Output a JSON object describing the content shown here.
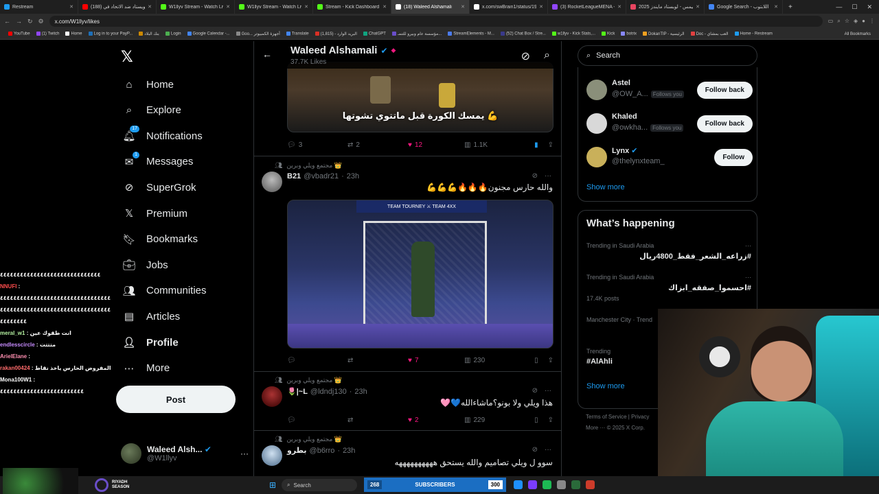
{
  "browser": {
    "tabs": [
      {
        "title": "Restream",
        "color": "#1d9bf0"
      },
      {
        "title": "(188) لويستاد ضد الاتحاد في",
        "color": "#ff0000"
      },
      {
        "title": "W1llyv Stream - Watch Live o",
        "color": "#53fc18"
      },
      {
        "title": "W1llyv Stream - Watch Live o",
        "color": "#53fc18"
      },
      {
        "title": "Stream - Kick Dashboard",
        "color": "#53fc18"
      },
      {
        "title": "(18) Waleed Alshamali",
        "color": "#ffffff"
      },
      {
        "title": "x.com/swBrain1/status/1945",
        "color": "#ffffff"
      },
      {
        "title": "(3) RocketLeagueMENA - Twi",
        "color": "#9146ff"
      },
      {
        "title": "2025 جيمس - لوبستاد مايندز",
        "color": "#e94560"
      },
      {
        "title": "Google Search - اللابتوب",
        "color": "#4285f4"
      }
    ],
    "url": "x.com/W1llyv/likes",
    "bookmarks": [
      "YouTube",
      "(1) Twitch",
      "Home",
      "Log in to your PayP...",
      "بنك البلاد",
      "Login",
      "Google Calendar -...",
      "Goo... أجهزة الكمبيوتر",
      "Translate",
      "(1,815) - البريد الوارد",
      "ChatGPT",
      "مؤسسة عام وبيرو للتنمـ...",
      "StreamElements - M...",
      "(52) Chat Box / Stre...",
      "w1llyv - Kick Stats,...",
      "Kick",
      "botrix",
      "DokanTIP - الرئيسية",
      "Doc - العب بمشاي",
      "Home - Restream"
    ],
    "all_bookmarks": "All Bookmarks"
  },
  "sidebar": {
    "items": [
      {
        "label": "Home",
        "icon": "home-icon"
      },
      {
        "label": "Explore",
        "icon": "search-icon"
      },
      {
        "label": "Notifications",
        "icon": "bell-icon",
        "badge": "17"
      },
      {
        "label": "Messages",
        "icon": "envelope-icon",
        "badge": "1"
      },
      {
        "label": "SuperGrok",
        "icon": "grok-icon"
      },
      {
        "label": "Premium",
        "icon": "x-icon"
      },
      {
        "label": "Bookmarks",
        "icon": "bookmark-icon"
      },
      {
        "label": "Jobs",
        "icon": "briefcase-icon"
      },
      {
        "label": "Communities",
        "icon": "people-icon"
      },
      {
        "label": "Articles",
        "icon": "article-icon"
      },
      {
        "label": "Profile",
        "icon": "person-icon"
      },
      {
        "label": "More",
        "icon": "more-circle-icon"
      }
    ],
    "post_label": "Post",
    "account_name": "Waleed Alsh...",
    "account_handle": "@W1llyv",
    "account_more": "···"
  },
  "chat": [
    {
      "user": "",
      "text": "٤٤٤٤٤٤٤٤٤٤٤٤٤٤٤٤٤٤٤٤٤٤٤٤٤٤٤٤٤٤",
      "color": "#ffffff"
    },
    {
      "user": "NNUFI",
      "text": " :",
      "color": "#ff4d4d"
    },
    {
      "user": "",
      "text": "٤٤٤٤٤٤٤٤٤٤٤٤٤٤٤٤٤٤٤٤٤٤٤٤٤٤٤٤٤٤٤٤٤",
      "color": "#ffffff"
    },
    {
      "user": "",
      "text": "٤٤٤٤٤٤٤٤٤٤٤٤٤٤٤٤٤٤٤٤٤٤٤٤٤٤٤٤٤٤٤٤٤",
      "color": "#ffffff"
    },
    {
      "user": "",
      "text": "٤٤٤٤٤٤٤٤",
      "color": "#ffffff"
    },
    {
      "user": "meral_w1",
      "text": " : انت طقوك عين",
      "color": "#b4f0a0"
    },
    {
      "user": "endlesscircle",
      "text": " : متتتت",
      "color": "#c88cff"
    },
    {
      "user": "ArielElane",
      "text": " :",
      "color": "#ff8fb1"
    },
    {
      "user": "rakan00424",
      "text": " : المفروض الحارس ياخذ نقاط",
      "color": "#ff6b6b"
    },
    {
      "user": "Mona100W1",
      "text": " :",
      "color": "#ffffff"
    },
    {
      "user": "",
      "text": "٤٤٤٤٤٤٤٤٤٤٤٤٤٤٤٤٤٤٤٤٤٤٤٤٤",
      "color": "#ffffff"
    }
  ],
  "timeline": {
    "title": "Waleed Alshamali",
    "subtitle": "37.7K Likes",
    "tweet0": {
      "caption": "يمسك الكورة قبل ماتتوي تشوتها 💪",
      "replies": "3",
      "reposts": "2",
      "likes": "12",
      "views": "1.1K"
    },
    "tweets": [
      {
        "context": "مجتمع ويلي وبرين 👑",
        "name": "B21",
        "handle": "@vbadr21",
        "time": "23h",
        "text": "والله حارس مجنون🔥🔥🔥💪💪💪",
        "replies": "",
        "reposts": "",
        "likes": "7",
        "views": "230",
        "scoreboard": "TEAM TOURNEY  ⚔  TEAM 4XX"
      },
      {
        "context": "مجتمع ويلي وبرين 👑",
        "name": "🌷|~L",
        "handle": "@ldndj130",
        "time": "23h",
        "text": "هذا ويلي ولا بونو؟ماشاءالله💙🩷",
        "replies": "",
        "reposts": "",
        "likes": "2",
        "views": "229"
      },
      {
        "context": "مجتمع ويلي وبرين 👑",
        "name": "بطرو",
        "handle": "@b6rro",
        "time": "23h",
        "text": "سوو ل ويلي تصاميم والله يستحق ههههههههههه"
      }
    ]
  },
  "right": {
    "search_placeholder": "Search",
    "who_to_follow": [
      {
        "name": "Astel",
        "handle": "@OW_A...",
        "follows_you": "Follows you",
        "button": "Follow back",
        "color": "#8a8f7a"
      },
      {
        "name": "Khaled",
        "handle": "@owkha...",
        "follows_you": "Follows you",
        "button": "Follow back",
        "color": "#d8d8d8"
      },
      {
        "name": "Lynx",
        "handle": "@thelynxteam_",
        "follows_you": "",
        "button": "Follow",
        "color": "#c9b05a"
      }
    ],
    "show_more": "Show more",
    "happening_title": "What’s happening",
    "trends": [
      {
        "context": "Trending in Saudi Arabia",
        "name": "#زراعه_الشعر_فقط_4800ريال",
        "posts": ""
      },
      {
        "context": "Trending in Saudi Arabia",
        "name": "#احسموا_صفقه_ابزاك",
        "posts": "17.4K posts"
      },
      {
        "context": "Manchester City · Trend",
        "name": "",
        "posts": ""
      },
      {
        "context": "Trending",
        "name": "#AlAhli",
        "posts": ""
      }
    ],
    "show_more_2": "Show more",
    "footer_line1": "Terms of Service  |  Privacy",
    "footer_line2": "More ···  © 2025 X Corp."
  },
  "taskbar": {
    "search": "Search",
    "sub_count": "268",
    "sub_label": "SUBSCRIBERS",
    "sub_goal": "300",
    "riyadh": "RIYADH\nSEASON"
  }
}
